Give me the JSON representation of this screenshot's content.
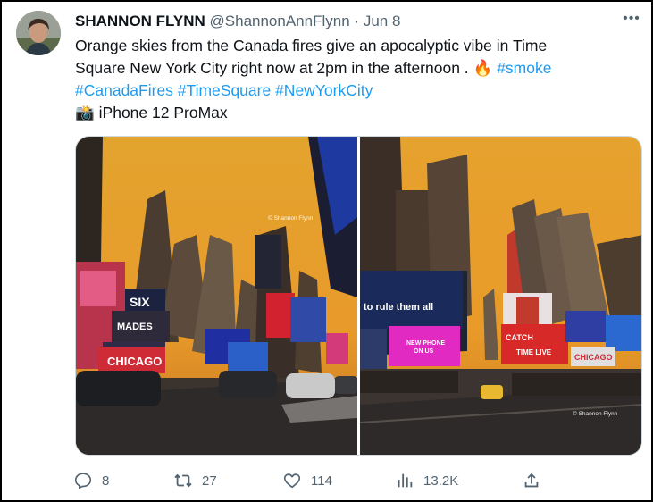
{
  "tweet": {
    "author_name": "SHANNON FLYNN",
    "handle": "@ShannonAnnFlynn",
    "separator": "·",
    "date": "Jun 8",
    "more_label": "•••",
    "text_line1": "Orange skies from the Canada fires give an apocalyptic vibe in Time",
    "text_line2a": "Square New York City right now at 2pm in the afternoon . ",
    "fire_emoji": "🔥",
    "hashtag_smoke": "#smoke",
    "hashtag_canadafires": "#CanadaFires",
    "hashtag_timesquare": "#TimeSquare",
    "hashtag_newyorkcity": "#NewYorkCity",
    "camera_emoji": "📸",
    "device_text": " iPhone 12 ProMax"
  },
  "photos": {
    "left": {
      "watermark": "© Shannon Flynn",
      "sign_six": "SIX",
      "sign_mades": "MADES",
      "sign_chicago": "CHICAGO"
    },
    "right": {
      "watermark": "© Shannon Flynn",
      "sign_rule": "to rule them all",
      "sign_phone_line1": "NEW PHONE",
      "sign_phone_line2": "ON US",
      "sign_catch": "CATCH",
      "sign_time": "TIME LIVE",
      "sign_chicago": "CHICAGO"
    }
  },
  "actions": {
    "reply_count": "8",
    "retweet_count": "27",
    "like_count": "114",
    "views_count": "13.2K"
  },
  "colors": {
    "hashtag": "#1d9bf0",
    "secondary_text": "#536471",
    "sky_orange": "#e6a12b"
  }
}
